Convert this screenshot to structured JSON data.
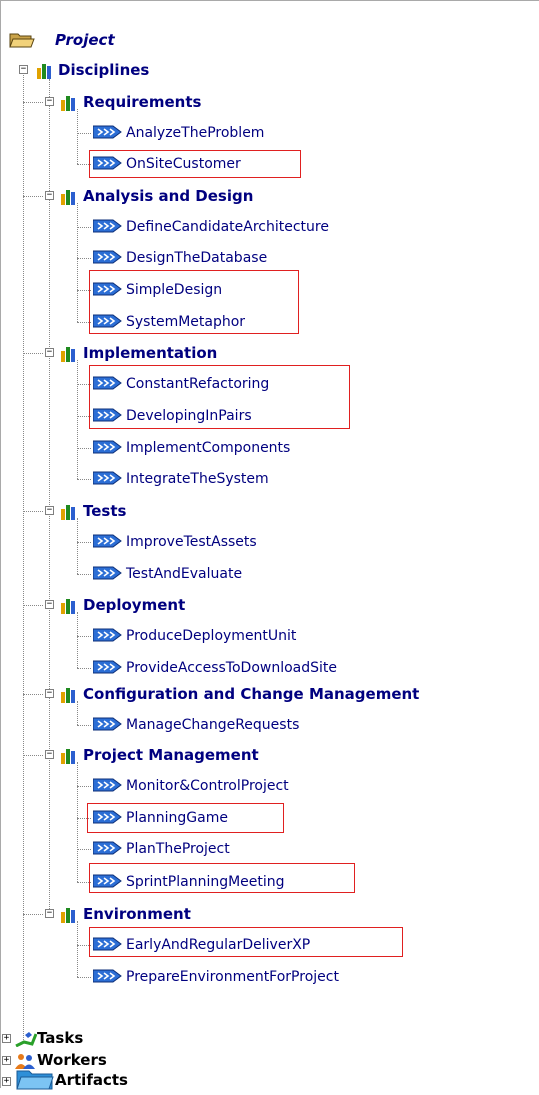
{
  "tree": {
    "root": "Project",
    "disciplines": "Disciplines",
    "groups": [
      {
        "label": "Requirements",
        "items": [
          "AnalyzeTheProblem",
          "OnSiteCustomer"
        ]
      },
      {
        "label": "Analysis and Design",
        "items": [
          "DefineCandidateArchitecture",
          "DesignTheDatabase",
          "SimpleDesign",
          "SystemMetaphor"
        ]
      },
      {
        "label": "Implementation",
        "items": [
          "ConstantRefactoring",
          "DevelopingInPairs",
          "ImplementComponents",
          "IntegrateTheSystem"
        ]
      },
      {
        "label": "Tests",
        "items": [
          "ImproveTestAssets",
          "TestAndEvaluate"
        ]
      },
      {
        "label": "Deployment",
        "items": [
          "ProduceDeploymentUnit",
          "ProvideAccessToDownloadSite"
        ]
      },
      {
        "label": "Configuration and Change Management",
        "items": [
          "ManageChangeRequests"
        ]
      },
      {
        "label": "Project Management",
        "items": [
          "Monitor&ControlProject",
          "PlanningGame",
          "PlanTheProject",
          "SprintPlanningMeeting"
        ]
      },
      {
        "label": "Environment",
        "items": [
          "EarlyAndRegularDeliverXP",
          "PrepareEnvironmentForProject"
        ]
      }
    ],
    "tasks": "Tasks",
    "workers": "Workers",
    "artifacts": "Artifacts",
    "expand_symbols": {
      "expanded": "−",
      "collapsed": "+"
    }
  },
  "icons": {
    "root": "open-folder-icon",
    "group": "discipline-chart-icon",
    "leaf": "workflow-arrow-icon",
    "tasks": "tasks-icon",
    "workers": "workers-icon",
    "artifacts": "artifacts-folder-icon"
  },
  "colors": {
    "label": "#00007f",
    "highlight": "#e02020",
    "tree_line": "#888888"
  }
}
